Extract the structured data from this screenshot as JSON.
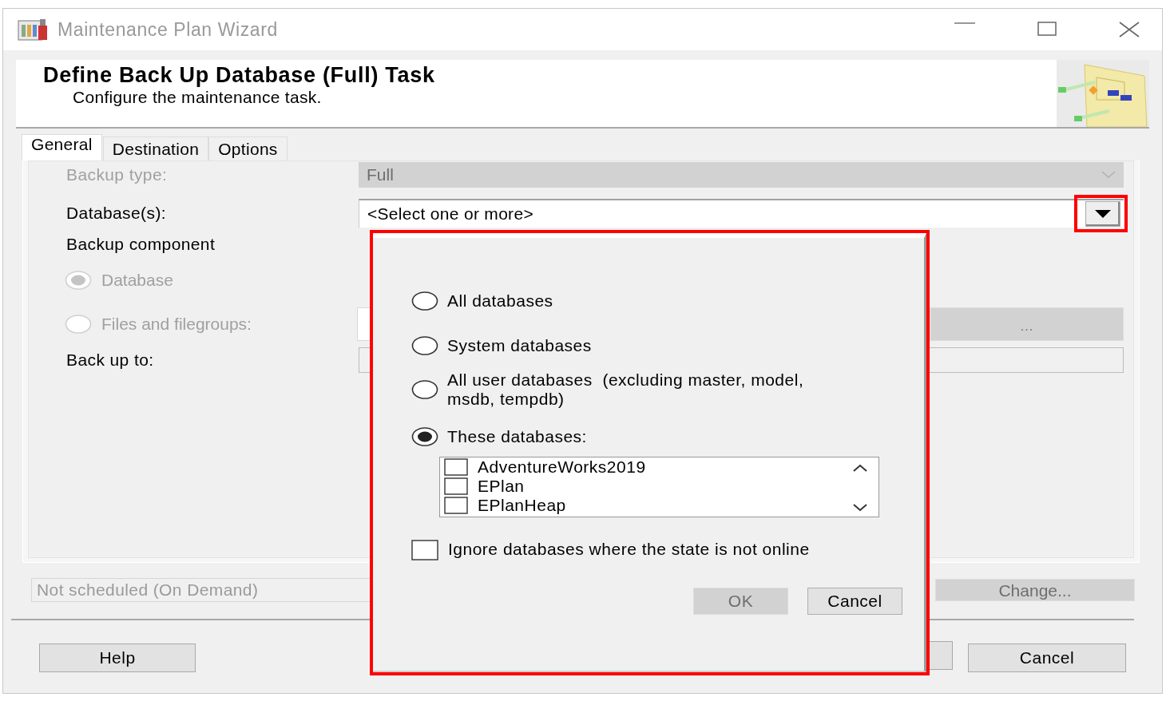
{
  "window": {
    "title": "Maintenance Plan Wizard"
  },
  "header": {
    "title": "Define Back Up Database (Full) Task",
    "subtitle": "Configure the maintenance task."
  },
  "tabs": [
    {
      "label": "General",
      "selected": true
    },
    {
      "label": "Destination",
      "selected": false
    },
    {
      "label": "Options",
      "selected": false
    }
  ],
  "form": {
    "backup_type": {
      "label": "Backup type:",
      "value": "Full",
      "disabled": true
    },
    "databases": {
      "label": "Database(s):",
      "value": "<Select one or more>"
    },
    "backup_component": {
      "label": "Backup component",
      "options": [
        {
          "label": "Database",
          "selected": true,
          "disabled": true
        },
        {
          "label": "Files and filegroups:",
          "selected": false,
          "disabled": true
        }
      ]
    },
    "browse_button": {
      "label": "...",
      "disabled": true
    },
    "back_up_to": {
      "label": "Back up to:"
    }
  },
  "schedule": {
    "value": "Not scheduled (On Demand)",
    "button": "Change...",
    "disabled": true
  },
  "buttons": [
    {
      "label": "Help"
    },
    {
      "label": "Cancel"
    }
  ],
  "popup": {
    "options": [
      {
        "label": "All databases",
        "selected": false
      },
      {
        "label": "System databases",
        "selected": false
      },
      {
        "label": "All user databases  (excluding master, model, msdb, tempdb)",
        "selected": false
      },
      {
        "label": "These databases:",
        "selected": true
      }
    ],
    "databases": [
      {
        "name": "AdventureWorks2019",
        "checked": false
      },
      {
        "name": "EPlan",
        "checked": false
      },
      {
        "name": "EPlanHeap",
        "checked": false
      }
    ],
    "ignore_offline": {
      "label": "Ignore databases where the state is not online",
      "checked": false
    },
    "buttons": [
      {
        "label": "OK",
        "disabled": true
      },
      {
        "label": "Cancel",
        "disabled": false
      }
    ]
  }
}
